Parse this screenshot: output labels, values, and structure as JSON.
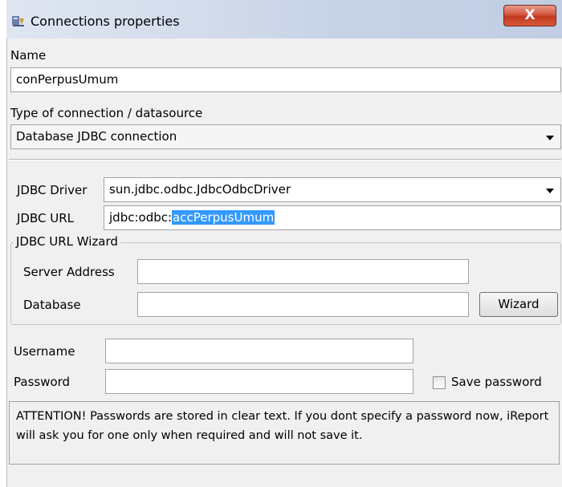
{
  "window": {
    "title": "Connections properties",
    "close_label": "X"
  },
  "name": {
    "label": "Name",
    "value": "conPerpusUmum"
  },
  "connection_type": {
    "label": "Type of connection / datasource",
    "selected": "Database JDBC connection"
  },
  "jdbc": {
    "driver_label": "JDBC Driver",
    "driver_value": "sun.jdbc.odbc.JdbcOdbcDriver",
    "url_label": "JDBC URL",
    "url_prefix": "jdbc:odbc:",
    "url_selected": "accPerpusUmum"
  },
  "wizard": {
    "group_title": "JDBC URL Wizard",
    "server_label": "Server Address",
    "server_value": "",
    "database_label": "Database",
    "database_value": "",
    "button_label": "Wizard"
  },
  "credentials": {
    "username_label": "Username",
    "username_value": "",
    "password_label": "Password",
    "password_value": "",
    "save_password_label": "Save password",
    "save_password_checked": false
  },
  "attention_text": "ATTENTION! Passwords are stored in clear text. If you dont specify a password now, iReport will ask you for one only when required and will not save it."
}
